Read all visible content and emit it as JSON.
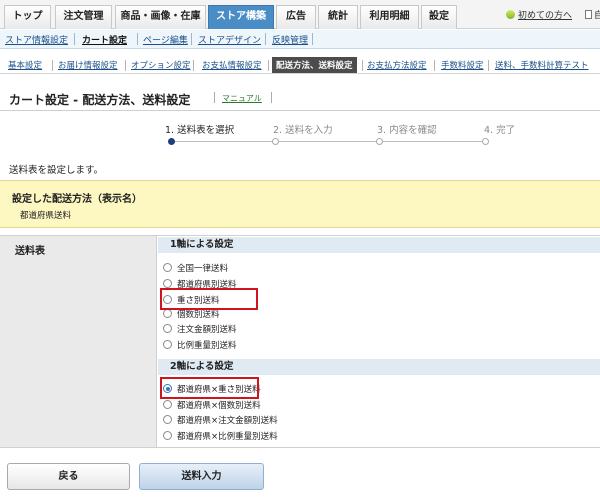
{
  "top_nav": {
    "tabs": [
      "トップ",
      "注文管理",
      "商品・画像・在庫",
      "ストア構築",
      "広告",
      "統計",
      "利用明細",
      "設定"
    ],
    "active": "ストア構築",
    "help_link": "初めての方へ",
    "extra_link": "自"
  },
  "sub_nav": {
    "items": [
      "ストア情報設定",
      "カート設定",
      "ページ編集",
      "ストアデザイン",
      "反映管理"
    ],
    "current": "カート設定"
  },
  "third_nav": {
    "items": [
      "基本設定",
      "お届け情報設定",
      "オプション設定",
      "お支払情報設定",
      "配送方法、送料設定",
      "お支払方法設定",
      "手数料設定",
      "送料、手数料計算テスト"
    ],
    "active": "配送方法、送料設定"
  },
  "page": {
    "title": "カート設定 - 配送方法、送料設定",
    "manual_link": "マニュアル"
  },
  "stepper": {
    "steps": [
      "1. 送料表を選択",
      "2. 送料を入力",
      "3. 内容を確認",
      "4. 完了"
    ],
    "current_step": 1
  },
  "intro_text": "送料表を設定します。",
  "shipping_method": {
    "heading": "設定した配送方法（表示名）",
    "value": "都道府県送料"
  },
  "form": {
    "row_label": "送料表",
    "section1": {
      "heading": "1軸による設定",
      "options": [
        "全国一律送料",
        "都道府県別送料",
        "重さ別送料",
        "個数別送料",
        "注文金額別送料",
        "比例重量別送料"
      ]
    },
    "section2": {
      "heading": "2軸による設定",
      "options": [
        "都道府県×重さ別送料",
        "都道府県×個数別送料",
        "都道府県×注文金額別送料",
        "都道府県×比例重量別送料"
      ]
    },
    "selected_option": "都道府県×重さ別送料",
    "highlighted_options": [
      "重さ別送料",
      "都道府県×重さ別送料"
    ]
  },
  "buttons": {
    "back": "戻る",
    "next": "送料入力"
  },
  "colors": {
    "active_tab": "#4a8cc6",
    "highlight_box": "#d0141e",
    "notice_bg": "#fdf7c2"
  }
}
